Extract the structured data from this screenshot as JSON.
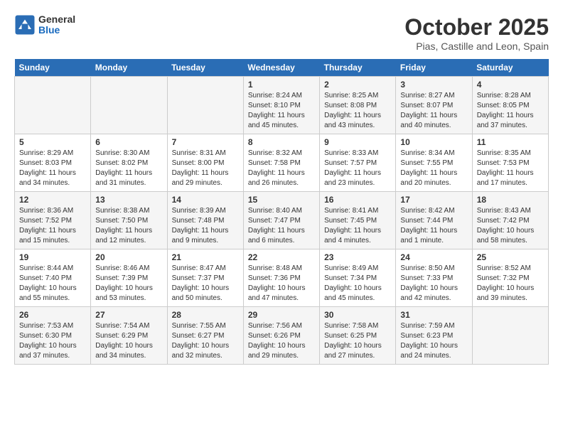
{
  "logo": {
    "general": "General",
    "blue": "Blue"
  },
  "title": "October 2025",
  "location": "Pias, Castille and Leon, Spain",
  "days_of_week": [
    "Sunday",
    "Monday",
    "Tuesday",
    "Wednesday",
    "Thursday",
    "Friday",
    "Saturday"
  ],
  "weeks": [
    [
      {
        "day": "",
        "info": ""
      },
      {
        "day": "",
        "info": ""
      },
      {
        "day": "",
        "info": ""
      },
      {
        "day": "1",
        "info": "Sunrise: 8:24 AM\nSunset: 8:10 PM\nDaylight: 11 hours and 45 minutes."
      },
      {
        "day": "2",
        "info": "Sunrise: 8:25 AM\nSunset: 8:08 PM\nDaylight: 11 hours and 43 minutes."
      },
      {
        "day": "3",
        "info": "Sunrise: 8:27 AM\nSunset: 8:07 PM\nDaylight: 11 hours and 40 minutes."
      },
      {
        "day": "4",
        "info": "Sunrise: 8:28 AM\nSunset: 8:05 PM\nDaylight: 11 hours and 37 minutes."
      }
    ],
    [
      {
        "day": "5",
        "info": "Sunrise: 8:29 AM\nSunset: 8:03 PM\nDaylight: 11 hours and 34 minutes."
      },
      {
        "day": "6",
        "info": "Sunrise: 8:30 AM\nSunset: 8:02 PM\nDaylight: 11 hours and 31 minutes."
      },
      {
        "day": "7",
        "info": "Sunrise: 8:31 AM\nSunset: 8:00 PM\nDaylight: 11 hours and 29 minutes."
      },
      {
        "day": "8",
        "info": "Sunrise: 8:32 AM\nSunset: 7:58 PM\nDaylight: 11 hours and 26 minutes."
      },
      {
        "day": "9",
        "info": "Sunrise: 8:33 AM\nSunset: 7:57 PM\nDaylight: 11 hours and 23 minutes."
      },
      {
        "day": "10",
        "info": "Sunrise: 8:34 AM\nSunset: 7:55 PM\nDaylight: 11 hours and 20 minutes."
      },
      {
        "day": "11",
        "info": "Sunrise: 8:35 AM\nSunset: 7:53 PM\nDaylight: 11 hours and 17 minutes."
      }
    ],
    [
      {
        "day": "12",
        "info": "Sunrise: 8:36 AM\nSunset: 7:52 PM\nDaylight: 11 hours and 15 minutes."
      },
      {
        "day": "13",
        "info": "Sunrise: 8:38 AM\nSunset: 7:50 PM\nDaylight: 11 hours and 12 minutes."
      },
      {
        "day": "14",
        "info": "Sunrise: 8:39 AM\nSunset: 7:48 PM\nDaylight: 11 hours and 9 minutes."
      },
      {
        "day": "15",
        "info": "Sunrise: 8:40 AM\nSunset: 7:47 PM\nDaylight: 11 hours and 6 minutes."
      },
      {
        "day": "16",
        "info": "Sunrise: 8:41 AM\nSunset: 7:45 PM\nDaylight: 11 hours and 4 minutes."
      },
      {
        "day": "17",
        "info": "Sunrise: 8:42 AM\nSunset: 7:44 PM\nDaylight: 11 hours and 1 minute."
      },
      {
        "day": "18",
        "info": "Sunrise: 8:43 AM\nSunset: 7:42 PM\nDaylight: 10 hours and 58 minutes."
      }
    ],
    [
      {
        "day": "19",
        "info": "Sunrise: 8:44 AM\nSunset: 7:40 PM\nDaylight: 10 hours and 55 minutes."
      },
      {
        "day": "20",
        "info": "Sunrise: 8:46 AM\nSunset: 7:39 PM\nDaylight: 10 hours and 53 minutes."
      },
      {
        "day": "21",
        "info": "Sunrise: 8:47 AM\nSunset: 7:37 PM\nDaylight: 10 hours and 50 minutes."
      },
      {
        "day": "22",
        "info": "Sunrise: 8:48 AM\nSunset: 7:36 PM\nDaylight: 10 hours and 47 minutes."
      },
      {
        "day": "23",
        "info": "Sunrise: 8:49 AM\nSunset: 7:34 PM\nDaylight: 10 hours and 45 minutes."
      },
      {
        "day": "24",
        "info": "Sunrise: 8:50 AM\nSunset: 7:33 PM\nDaylight: 10 hours and 42 minutes."
      },
      {
        "day": "25",
        "info": "Sunrise: 8:52 AM\nSunset: 7:32 PM\nDaylight: 10 hours and 39 minutes."
      }
    ],
    [
      {
        "day": "26",
        "info": "Sunrise: 7:53 AM\nSunset: 6:30 PM\nDaylight: 10 hours and 37 minutes."
      },
      {
        "day": "27",
        "info": "Sunrise: 7:54 AM\nSunset: 6:29 PM\nDaylight: 10 hours and 34 minutes."
      },
      {
        "day": "28",
        "info": "Sunrise: 7:55 AM\nSunset: 6:27 PM\nDaylight: 10 hours and 32 minutes."
      },
      {
        "day": "29",
        "info": "Sunrise: 7:56 AM\nSunset: 6:26 PM\nDaylight: 10 hours and 29 minutes."
      },
      {
        "day": "30",
        "info": "Sunrise: 7:58 AM\nSunset: 6:25 PM\nDaylight: 10 hours and 27 minutes."
      },
      {
        "day": "31",
        "info": "Sunrise: 7:59 AM\nSunset: 6:23 PM\nDaylight: 10 hours and 24 minutes."
      },
      {
        "day": "",
        "info": ""
      }
    ]
  ]
}
